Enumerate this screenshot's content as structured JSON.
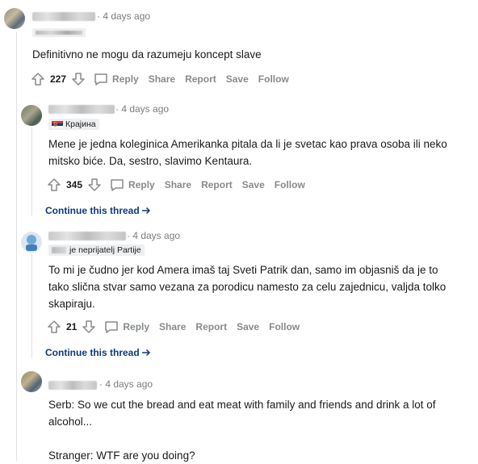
{
  "comments": [
    {
      "time": "· 4 days ago",
      "flair": "",
      "lines": [
        "Definitivno ne mogu da razumeju koncept slave"
      ],
      "votes": "227"
    },
    {
      "time": "· 4 days ago",
      "flair": "Крајина",
      "lines": [
        "Mene je jedna koleginica Amerikanka pitala da li je svetac kao prava osoba ili neko",
        "mitsko biće. Da, sestro, slavimo Kentaura."
      ],
      "votes": "345",
      "continue": "Continue this thread"
    },
    {
      "time": "· 4 days ago",
      "flair": "je neprijatelj Partije",
      "lines": [
        "To mi je čudno jer kod Amera imaš taj Sveti Patrik dan, samo im objasniš da je to",
        "tako slična stvar samo vezana za porodicu namesto za celu zajednicu, valjda tolko",
        "skapiraju."
      ],
      "votes": "21",
      "continue": "Continue this thread"
    },
    {
      "time": "· 4 days ago",
      "lines": [
        "Serb: So we cut the bread and eat meat with family and friends and drink a lot of",
        "alcohol...",
        "",
        "Stranger: WTF are you doing?"
      ]
    }
  ],
  "actions": {
    "reply": "Reply",
    "share": "Share",
    "report": "Report",
    "save": "Save",
    "follow": "Follow"
  },
  "icons": [
    "upvote-icon",
    "downvote-icon",
    "reply-bubble-icon",
    "arrow-right-icon",
    "serbia-flag-icon"
  ],
  "colors": {
    "link": "#0d3a7a",
    "meta": "#7c7c7c",
    "action": "#878a8c"
  }
}
